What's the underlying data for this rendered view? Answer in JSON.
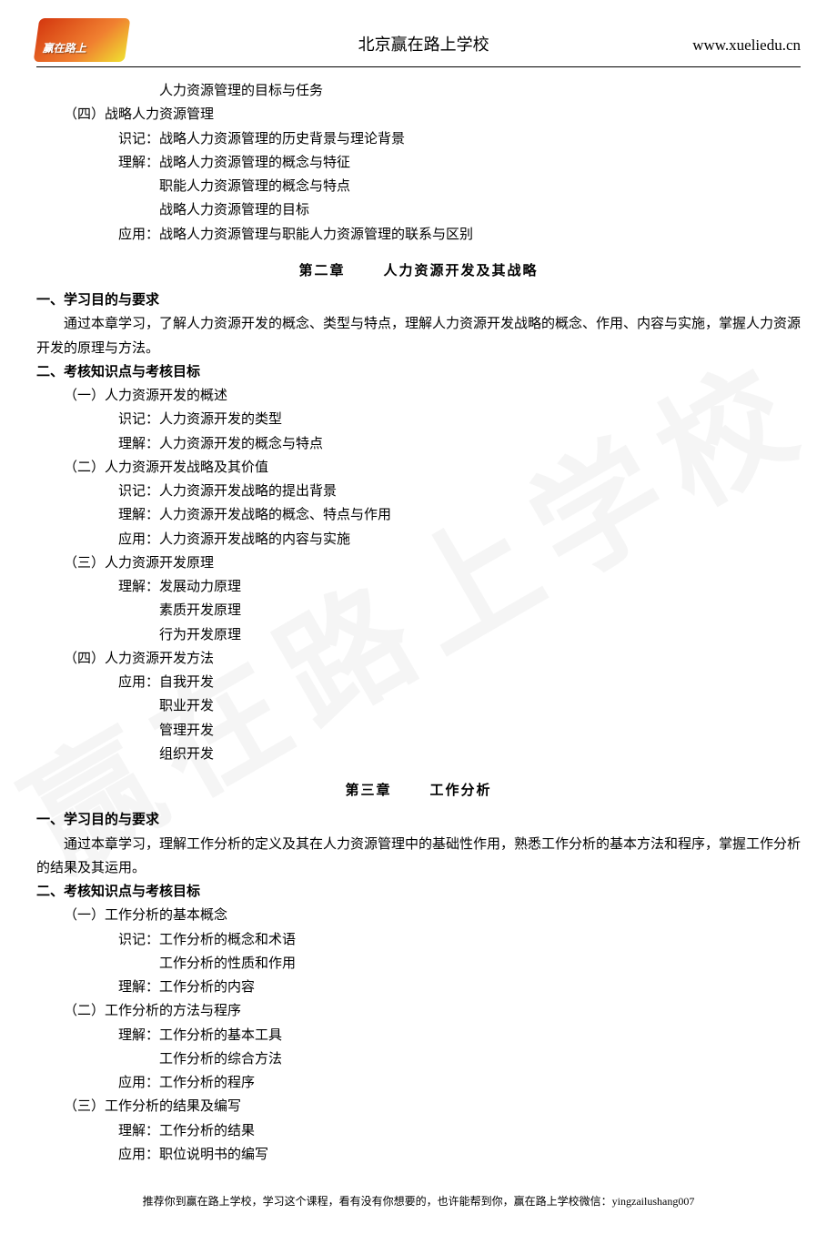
{
  "header": {
    "logo_small": "赢在路上",
    "center": "北京赢在路上学校",
    "url": "www.xueliedu.cn"
  },
  "watermark_text": "赢在路上学校",
  "top_fragment": {
    "l1": "人力资源管理的目标与任务",
    "l2": "（四）战略人力资源管理",
    "l3": "识记：战略人力资源管理的历史背景与理论背景",
    "l4": "理解：战略人力资源管理的概念与特征",
    "l5": "职能人力资源管理的概念与特点",
    "l6": "战略人力资源管理的目标",
    "l7": "应用：战略人力资源管理与职能人力资源管理的联系与区别"
  },
  "chapter2": {
    "num": "第二章",
    "title": "人力资源开发及其战略",
    "s1_title": "一、学习目的与要求",
    "s1_body": "通过本章学习，了解人力资源开发的概念、类型与特点，理解人力资源开发战略的概念、作用、内容与实施，掌握人力资源开发的原理与方法。",
    "s2_title": "二、考核知识点与考核目标",
    "i1": "（一）人力资源开发的概述",
    "i1a": "识记：人力资源开发的类型",
    "i1b": "理解：人力资源开发的概念与特点",
    "i2": "（二）人力资源开发战略及其价值",
    "i2a": "识记：人力资源开发战略的提出背景",
    "i2b": "理解：人力资源开发战略的概念、特点与作用",
    "i2c": "应用：人力资源开发战略的内容与实施",
    "i3": "（三）人力资源开发原理",
    "i3a": "理解：发展动力原理",
    "i3b": "素质开发原理",
    "i3c": "行为开发原理",
    "i4": "（四）人力资源开发方法",
    "i4a": "应用：自我开发",
    "i4b": "职业开发",
    "i4c": "管理开发",
    "i4d": "组织开发"
  },
  "chapter3": {
    "num": "第三章",
    "title": "工作分析",
    "s1_title": "一、学习目的与要求",
    "s1_body": "通过本章学习，理解工作分析的定义及其在人力资源管理中的基础性作用，熟悉工作分析的基本方法和程序，掌握工作分析的结果及其运用。",
    "s2_title": "二、考核知识点与考核目标",
    "i1": "（一）工作分析的基本概念",
    "i1a": "识记：工作分析的概念和术语",
    "i1b": "工作分析的性质和作用",
    "i1c": "理解：工作分析的内容",
    "i2": "（二）工作分析的方法与程序",
    "i2a": "理解：工作分析的基本工具",
    "i2b": "工作分析的综合方法",
    "i2c": "应用：工作分析的程序",
    "i3": "（三）工作分析的结果及编写",
    "i3a": "理解：工作分析的结果",
    "i3b": "应用：职位说明书的编写"
  },
  "footer_text": "推荐你到赢在路上学校，学习这个课程，看有没有你想要的，也许能帮到你，赢在路上学校微信：yingzailushang007"
}
